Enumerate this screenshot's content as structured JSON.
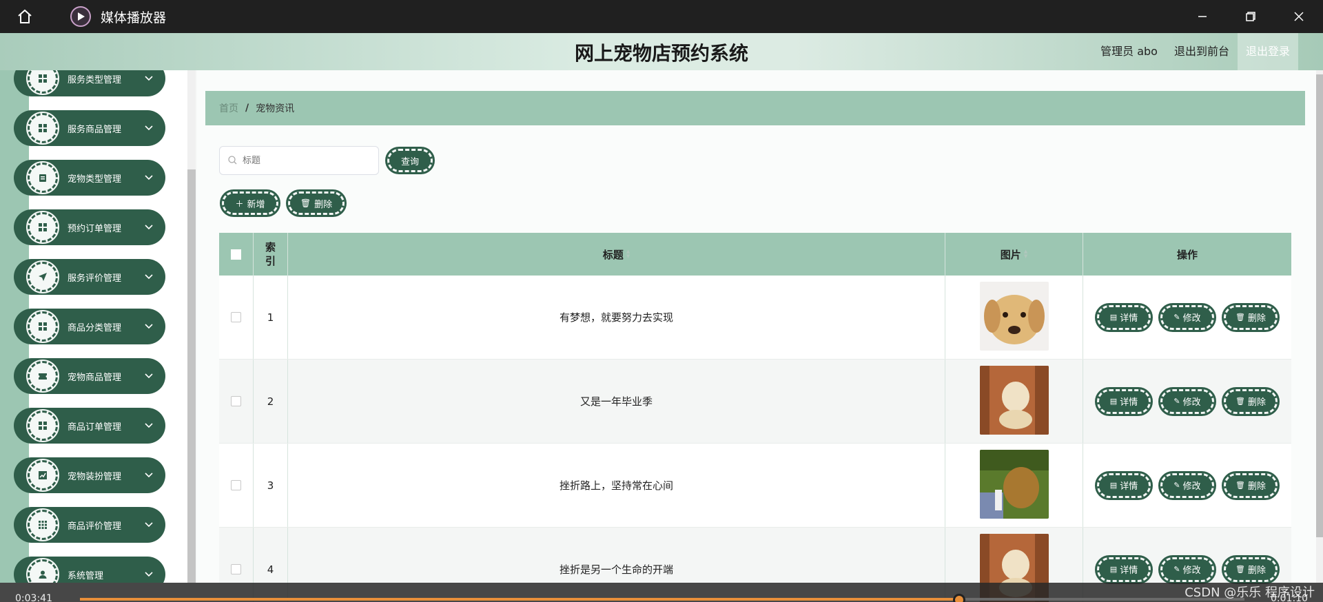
{
  "window": {
    "title": "媒体播放器"
  },
  "header": {
    "title": "网上宠物店预约系统",
    "admin": "管理员 abo",
    "back_front": "退出到前台",
    "logout": "退出登录"
  },
  "sidebar": {
    "items": [
      {
        "label": "服务类型管理",
        "icon": "grid-icon"
      },
      {
        "label": "服务商品管理",
        "icon": "grid-icon"
      },
      {
        "label": "宠物类型管理",
        "icon": "clipboard-icon"
      },
      {
        "label": "预约订单管理",
        "icon": "grid-icon"
      },
      {
        "label": "服务评价管理",
        "icon": "send-icon"
      },
      {
        "label": "商品分类管理",
        "icon": "grid-icon"
      },
      {
        "label": "宠物商品管理",
        "icon": "ticket-icon"
      },
      {
        "label": "商品订单管理",
        "icon": "grid-icon"
      },
      {
        "label": "宠物装扮管理",
        "icon": "chart-icon"
      },
      {
        "label": "商品评价管理",
        "icon": "apps-icon"
      },
      {
        "label": "系统管理",
        "icon": "user-icon"
      }
    ]
  },
  "breadcrumb": {
    "home": "首页",
    "separator": "/",
    "current": "宠物资讯"
  },
  "search": {
    "placeholder": "标题",
    "button": "查询"
  },
  "toolbar": {
    "add": "新增",
    "delete": "删除"
  },
  "table": {
    "headers": {
      "index": "索引",
      "title": "标题",
      "image": "图片",
      "ops": "操作"
    },
    "rows": [
      {
        "index": "1",
        "title": "有梦想，就要努力去实现"
      },
      {
        "index": "2",
        "title": "又是一年毕业季"
      },
      {
        "index": "3",
        "title": "挫折路上，坚持常在心间"
      },
      {
        "index": "4",
        "title": "挫折是另一个生命的开端"
      }
    ],
    "ops": {
      "detail": "详情",
      "edit": "修改",
      "delete": "删除"
    }
  },
  "player": {
    "elapsed": "0:03:41",
    "remaining": "0:01:10",
    "progress_fraction": 0.755,
    "watermark": "CSDN @乐乐 程序设计"
  },
  "colors": {
    "primary": "#2f5e4a",
    "accent": "#9cc6b2",
    "progress": "#e88f3a"
  }
}
